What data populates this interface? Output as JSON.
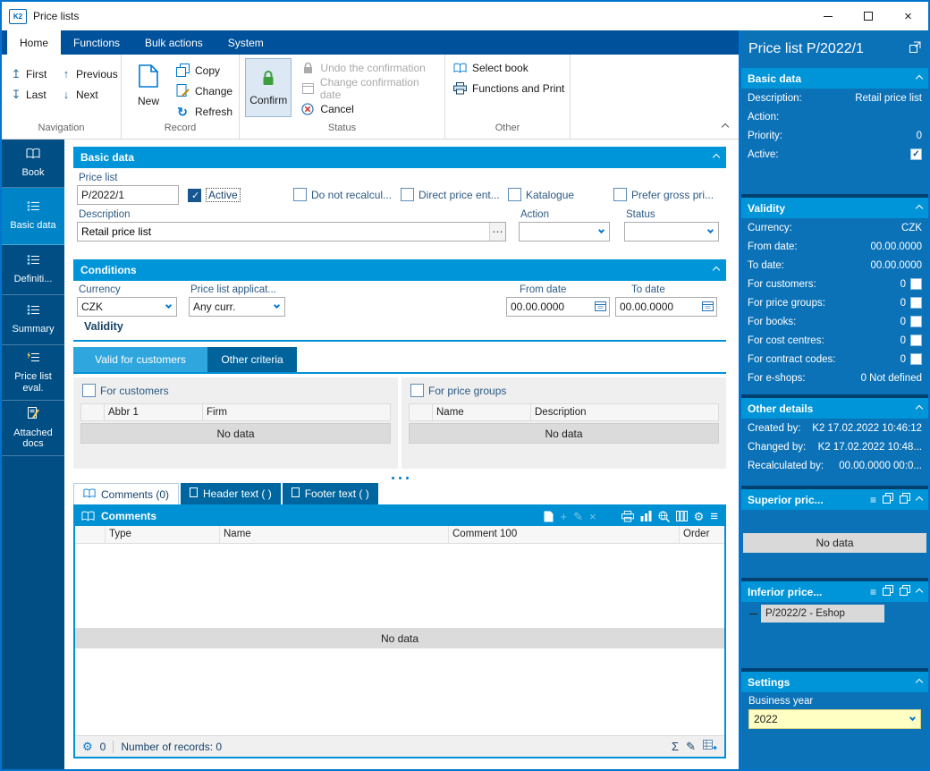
{
  "window": {
    "title": "Price lists",
    "logo": "K2"
  },
  "icons": {
    "close": "×",
    "first": "↥",
    "previous": "↑",
    "last": "↧",
    "next": "↓",
    "refresh": "↻",
    "ellipsis": "⋯",
    "gear": "⚙",
    "menu": "≡",
    "sum": "Σ",
    "pencil": "✎",
    "add": "+",
    "delete": "×"
  },
  "ribbon": {
    "tabs": {
      "home": "Home",
      "functions": "Functions",
      "bulk": "Bulk actions",
      "system": "System"
    },
    "first": "First",
    "previous": "Previous",
    "last": "Last",
    "next": "Next",
    "new": "New",
    "copy": "Copy",
    "change": "Change",
    "refresh": "Refresh",
    "confirm": "Confirm",
    "undo_confirmation": "Undo the confirmation",
    "change_confirmation_date": "Change confirmation date",
    "cancel": "Cancel",
    "select_book": "Select book",
    "functions_and_print": "Functions and Print",
    "labels": {
      "navigation": "Navigation",
      "record": "Record",
      "status": "Status",
      "other": "Other"
    }
  },
  "sidebar": {
    "items": [
      {
        "label": "Book"
      },
      {
        "label": "Basic data"
      },
      {
        "label": "Definiti..."
      },
      {
        "label": "Summary"
      },
      {
        "label": "Price list eval."
      },
      {
        "label": "Attached docs"
      }
    ]
  },
  "main": {
    "basic": {
      "title": "Basic data",
      "price_list_label": "Price list",
      "price_list_value": "P/2022/1",
      "active": "Active",
      "cb1": "Do not recalcul...",
      "cb2": "Direct price ent...",
      "cb3": "Katalogue",
      "cb4": "Prefer gross pri...",
      "description_label": "Description",
      "description_value": "Retail price list",
      "action_label": "Action",
      "status_label": "Status"
    },
    "conditions": {
      "title": "Conditions",
      "currency_label": "Currency",
      "currency_value": "CZK",
      "applicability_label": "Price list applicat...",
      "applicability_value": "Any curr.",
      "from_label": "From date",
      "from_value": "00.00.0000",
      "to_label": "To date",
      "to_value": "00.00.0000",
      "validity": "Validity",
      "tab_customers": "Valid for customers",
      "tab_other": "Other criteria",
      "for_customers": "For customers",
      "for_price_groups": "For price groups",
      "cust_col1": "Abbr 1",
      "cust_col2": "Firm",
      "pg_col1": "Name",
      "pg_col2": "Description",
      "no_data": "No data"
    },
    "bottom_tabs": {
      "comments": "Comments (0)",
      "header": "Header text ( )",
      "footer": "Footer text ( )"
    },
    "comments": {
      "title": "Comments",
      "col_type": "Type",
      "col_name": "Name",
      "col_comment": "Comment 100",
      "col_order": "Order",
      "no_data": "No data",
      "counter": "0",
      "records": "Number of records: 0"
    }
  },
  "panel": {
    "title": "Price list P/2022/1",
    "basic": {
      "title": "Basic data",
      "rows": [
        {
          "label": "Description:",
          "value": "Retail price list"
        },
        {
          "label": "Action:",
          "value": ""
        },
        {
          "label": "Priority:",
          "value": "0"
        },
        {
          "label": "Active:",
          "value": ""
        }
      ]
    },
    "validity": {
      "title": "Validity",
      "rows": [
        {
          "label": "Currency:",
          "value": "CZK"
        },
        {
          "label": "From date:",
          "value": "00.00.0000"
        },
        {
          "label": "To date:",
          "value": "00.00.0000"
        },
        {
          "label": "For customers:",
          "value": "0"
        },
        {
          "label": "For price groups:",
          "value": "0"
        },
        {
          "label": "For books:",
          "value": "0"
        },
        {
          "label": "For cost centres:",
          "value": "0"
        },
        {
          "label": "For contract codes:",
          "value": "0"
        },
        {
          "label": "For e-shops:",
          "value": "0 Not defined"
        }
      ]
    },
    "other": {
      "title": "Other details",
      "rows": [
        {
          "label": "Created by:",
          "value": "K2 17.02.2022 10:46:12"
        },
        {
          "label": "Changed by:",
          "value": "K2 17.02.2022 10:48..."
        },
        {
          "label": "Recalculated by:",
          "value": "00.00.0000 00:0..."
        }
      ]
    },
    "superior": {
      "title": "Superior pric...",
      "no_data": "No data"
    },
    "inferior": {
      "title": "Inferior price...",
      "item": "P/2022/2 - Eshop"
    },
    "settings": {
      "title": "Settings",
      "business_year": "Business year",
      "year_value": "2022"
    }
  }
}
